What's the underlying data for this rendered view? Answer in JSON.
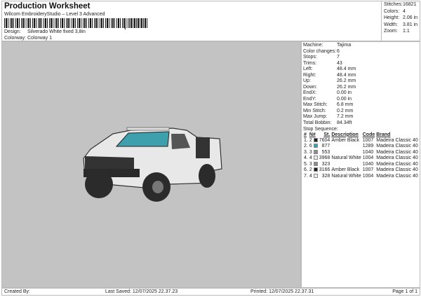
{
  "header": {
    "title": "Production Worksheet",
    "subtitle": "Wilcom EmbroideryStudio – Level 3 Advanced",
    "barcode_suffix": ",",
    "design_label": "Design:",
    "design": "Silverado White fixed 3,8in",
    "colorway_label": "Colorway:",
    "colorway": "Colorway 1"
  },
  "stats": [
    {
      "k": "Stitches:",
      "v": "16821"
    },
    {
      "k": "Colors:",
      "v": "4"
    },
    {
      "k": "Height:",
      "v": "2.06 in"
    },
    {
      "k": "Width:",
      "v": "3.81 in"
    },
    {
      "k": "Zoom:",
      "v": "1:1"
    }
  ],
  "machine": [
    {
      "k": "Machine:",
      "v": "Tajima"
    },
    {
      "k": "Color changes:",
      "v": "6"
    },
    {
      "k": "Stops:",
      "v": "7"
    },
    {
      "k": "Trims:",
      "v": "43"
    },
    {
      "k": "Left:",
      "v": "48.4 mm"
    },
    {
      "k": "Right:",
      "v": "48.4 mm"
    },
    {
      "k": "Up:",
      "v": "26.2 mm"
    },
    {
      "k": "Down:",
      "v": "26.2 mm"
    },
    {
      "k": "EndX:",
      "v": "0.00 in"
    },
    {
      "k": "EndY:",
      "v": "0.00 in"
    },
    {
      "k": "Max Stitch:",
      "v": "6.8 mm"
    },
    {
      "k": "Min Stitch:",
      "v": "0.2 mm"
    },
    {
      "k": "Max Jump:",
      "v": "7.2 mm"
    },
    {
      "k": "Total Bobbin:",
      "v": "84.34ft"
    }
  ],
  "stop_sequence": {
    "label": "Stop Sequence:",
    "headers": [
      "#",
      "N#",
      "St.",
      "Description",
      "Code",
      "Brand"
    ],
    "rows": [
      {
        "n": "1.",
        "c": "2",
        "color": "#1e1e1e",
        "st": "7604",
        "desc": "Amber Black",
        "code": "1007",
        "brand": "Madeira Classic 40"
      },
      {
        "n": "2.",
        "c": "6",
        "color": "#3a9fb0",
        "st": "877",
        "desc": "",
        "code": "1289",
        "brand": "Madeira Classic 40"
      },
      {
        "n": "3.",
        "c": "3",
        "color": "#8c8c8c",
        "st": "553",
        "desc": "",
        "code": "1040",
        "brand": "Madeira Classic 40"
      },
      {
        "n": "4.",
        "c": "4",
        "color": "#ececec",
        "st": "3968",
        "desc": "Natural White",
        "code": "1004",
        "brand": "Madeira Classic 40"
      },
      {
        "n": "5.",
        "c": "3",
        "color": "#8c8c8c",
        "st": "323",
        "desc": "",
        "code": "1040",
        "brand": "Madeira Classic 40"
      },
      {
        "n": "6.",
        "c": "2",
        "color": "#1e1e1e",
        "st": "3166",
        "desc": "Amber Black",
        "code": "1007",
        "brand": "Madeira Classic 40"
      },
      {
        "n": "7.",
        "c": "4",
        "color": "#ececec",
        "st": "328",
        "desc": "Natural White",
        "code": "1004",
        "brand": "Madeira Classic 40"
      }
    ]
  },
  "footer": {
    "created": "Created By:",
    "saved": "Last Saved: 12/07/2025 22.37.23",
    "printed": "Printed: 12/07/2025 22.37.31",
    "page": "Page 1 of 1"
  }
}
